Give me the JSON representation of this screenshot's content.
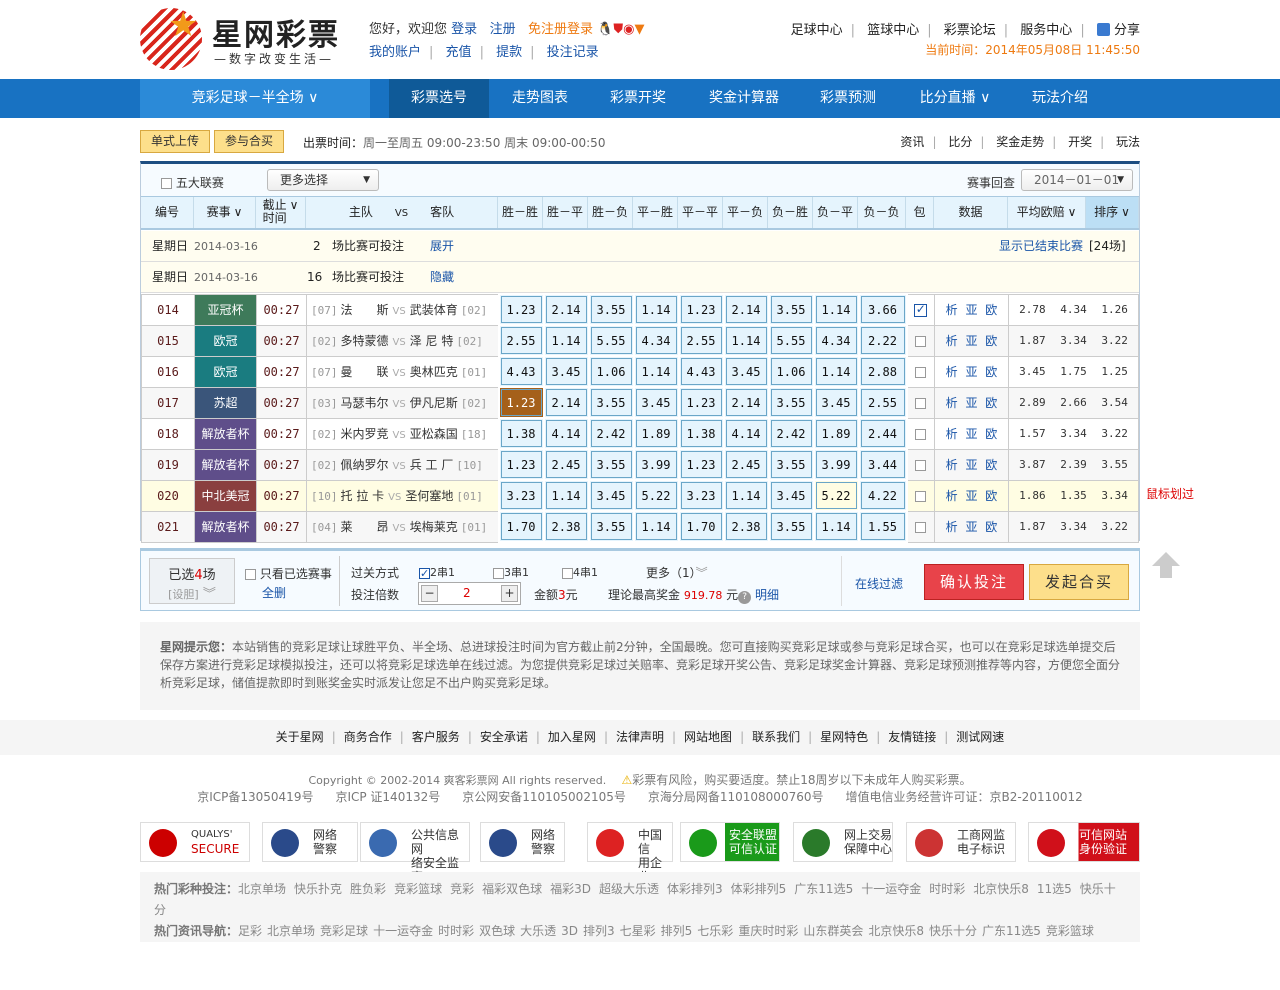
{
  "logo": {
    "name": "星网彩票",
    "slogan": "—数字改变生活—"
  },
  "header": {
    "greeting": "您好，欢迎您",
    "login": "登录",
    "register": "注册",
    "free_login": "免注册登录",
    "account": "我的账户",
    "recharge": "充值",
    "withdraw": "提款",
    "records": "投注记录",
    "right_links": [
      "足球中心",
      "篮球中心",
      "彩票论坛",
      "服务中心"
    ],
    "share": "分享",
    "time": "当前时间：2014年05月08日 11:45:50"
  },
  "nav": {
    "lottery": "竞彩足球－半全场",
    "items": [
      "彩票选号",
      "走势图表",
      "彩票开奖",
      "奖金计算器",
      "彩票预测",
      "比分直播",
      "玩法介绍"
    ],
    "active": 0
  },
  "toolbar": {
    "upload": "单式上传",
    "join": "参与合买",
    "ticket_label": "出票时间：",
    "ticket_time": "周一至周五 09:00-23:50  周末 09:00-00:50",
    "right_links": [
      "资讯",
      "比分",
      "奖金走势",
      "开奖",
      "玩法"
    ]
  },
  "filter": {
    "five_leagues": "五大联赛",
    "more": "更多选择",
    "review": "赛事回查",
    "date": "2014－01－01"
  },
  "columns": [
    "编号",
    "赛事",
    "截止时间",
    "主队",
    "VS",
    "客队",
    "胜－胜",
    "胜－平",
    "胜－负",
    "平－胜",
    "平－平",
    "平－负",
    "负－胜",
    "负－平",
    "负－负",
    "包",
    "数据",
    "平均欧赔",
    "排序"
  ],
  "groups": [
    {
      "day": "星期日",
      "date": "2014-03-16",
      "count": "2",
      "text": "场比赛可投注",
      "toggle": "展开",
      "show_ended": "显示已结束比赛",
      "ended_count": "[24场]"
    },
    {
      "day": "星期日",
      "date": "2014-03-16",
      "count": "16",
      "text": "场比赛可投注",
      "toggle": "隐藏"
    }
  ],
  "matches": [
    {
      "no": "014",
      "league": "亚冠杯",
      "color": "#3e7a5a",
      "time": "00:27",
      "hrank": "[07]",
      "home": "法　　斯",
      "away": "武装体育",
      "arank": "[02]",
      "odds": [
        "1.23",
        "2.14",
        "3.55",
        "1.14",
        "1.23",
        "2.14",
        "3.55",
        "1.14",
        "3.66"
      ],
      "checked": true,
      "avg": "2.78 4.34 1.26"
    },
    {
      "no": "015",
      "league": "欧冠",
      "color": "#1a7c80",
      "time": "00:27",
      "hrank": "[02]",
      "home": "多特蒙德",
      "away": "泽 尼 特",
      "arank": "[02]",
      "odds": [
        "2.55",
        "1.14",
        "5.55",
        "4.34",
        "2.55",
        "1.14",
        "5.55",
        "4.34",
        "2.22"
      ],
      "checked": false,
      "avg": "1.87 3.34 3.22"
    },
    {
      "no": "016",
      "league": "欧冠",
      "color": "#1a7c80",
      "time": "00:27",
      "hrank": "[07]",
      "home": "曼　　联",
      "away": "奥林匹克",
      "arank": "[01]",
      "odds": [
        "4.43",
        "3.45",
        "1.06",
        "1.14",
        "4.43",
        "3.45",
        "1.06",
        "1.14",
        "2.88"
      ],
      "checked": false,
      "avg": "3.45 1.75 1.25"
    },
    {
      "no": "017",
      "league": "苏超",
      "color": "#3a557a",
      "time": "00:27",
      "hrank": "[03]",
      "home": "马瑟韦尔",
      "away": "伊凡尼斯",
      "arank": "[02]",
      "odds": [
        "1.23",
        "2.14",
        "3.55",
        "3.45",
        "1.23",
        "2.14",
        "3.55",
        "3.45",
        "2.55"
      ],
      "checked": false,
      "selected_odd": 0,
      "avg": "2.89 2.66 3.54"
    },
    {
      "no": "018",
      "league": "解放者杯",
      "color": "#5f4e8a",
      "time": "00:27",
      "hrank": "[02]",
      "home": "米内罗竞",
      "away": "亚松森国",
      "arank": "[18]",
      "odds": [
        "1.38",
        "4.14",
        "2.42",
        "1.89",
        "1.38",
        "4.14",
        "2.42",
        "1.89",
        "2.44"
      ],
      "checked": false,
      "avg": "1.57 3.34 3.22"
    },
    {
      "no": "019",
      "league": "解放者杯",
      "color": "#5f4e8a",
      "time": "00:27",
      "hrank": "[02]",
      "home": "佩纳罗尔",
      "away": "兵 工 厂",
      "arank": "[10]",
      "odds": [
        "1.23",
        "2.45",
        "3.55",
        "3.99",
        "1.23",
        "2.45",
        "3.55",
        "3.99",
        "3.44"
      ],
      "checked": false,
      "avg": "3.87 2.39 3.55"
    },
    {
      "no": "020",
      "league": "中北美冠",
      "color": "#8a3f3f",
      "time": "00:27",
      "hrank": "[10]",
      "home": "托 拉 卡",
      "away": "圣何塞地",
      "arank": "[01]",
      "odds": [
        "3.23",
        "1.14",
        "3.45",
        "5.22",
        "3.23",
        "1.14",
        "3.45",
        "5.22",
        "4.22"
      ],
      "checked": false,
      "hover": true,
      "hover_odd": 7,
      "avg": "1.86 1.35 3.34"
    },
    {
      "no": "021",
      "league": "解放者杯",
      "color": "#5f4e8a",
      "time": "00:27",
      "hrank": "[04]",
      "home": "莱　　昂",
      "away": "埃梅莱克",
      "arank": "[01]",
      "odds": [
        "1.70",
        "2.38",
        "3.55",
        "1.14",
        "1.70",
        "2.38",
        "3.55",
        "1.14",
        "1.55"
      ],
      "checked": false,
      "avg": "1.87 3.34 3.22"
    }
  ],
  "data_links": "析 亚 欧",
  "hover_note": "鼠标划过",
  "betbar": {
    "selected_pre": "已选",
    "selected_count": "4",
    "selected_post": "场",
    "setting": "[设胆]",
    "only_selected": "只看已选赛事",
    "clear_all": "全删",
    "pass_label": "过关方式",
    "pass_options": [
      "2串1",
      "3串1",
      "4串1"
    ],
    "pass_checked": 0,
    "more": "更多（1）",
    "multiple_label": "投注倍数",
    "multiple": "2",
    "amount_label": "金额",
    "amount": "3",
    "yuan": "元",
    "max_prize_label": "理论最高奖金",
    "max_prize": "919.78",
    "detail": "明细",
    "filter": "在线过滤",
    "confirm": "确认投注",
    "group_buy": "发起合买"
  },
  "notice": {
    "title": "星网提示您：",
    "text": "本站销售的竞彩足球让球胜平负、半全场、总进球投注时间为官方截止前2分钟，全国最晚。您可直接购买竞彩足球或参与竞彩足球合买，也可以在竞彩足球选单提交后保存方案进行竞彩足球模拟投注，还可以将竞彩足球选单在线过滤。为您提供竞彩足球过关赔率、竞彩足球开奖公告、竞彩足球奖金计算器、竞彩足球预测推荐等内容，方便您全面分析竞彩足球，储值提款即时到账奖金实时派发让您足不出户购买竞彩足球。"
  },
  "footer_links": [
    "关于星网",
    "商务合作",
    "客户服务",
    "安全承诺",
    "加入星网",
    "法律声明",
    "网站地图",
    "联系我们",
    "星网特色",
    "友情链接",
    "测试网速"
  ],
  "copyright": {
    "line1": "Copyright © 2002-2014 爽客彩票网    All rights reserved.",
    "warning": "彩票有风险，购买要适度。禁止18周岁以下未成年人购买彩票。",
    "icp": [
      "京ICP备13050419号",
      "京ICP 证140132号",
      "京公网安备110105002105号",
      "京海分局网备110108000760号",
      "增值电信业务经营许可证：京B2-20110012"
    ]
  },
  "badges": [
    {
      "l1": "QUALYS'",
      "l2": "SECURE",
      "color": "#c00"
    },
    {
      "l1": "网络",
      "l2": "警察",
      "color": "#2a4a8a"
    },
    {
      "l1": "公共信息网",
      "l2": "络安全监察",
      "color": "#3a6ab0"
    },
    {
      "l1": "网络",
      "l2": "警察",
      "color": "#2a4a8a"
    },
    {
      "l1": "中国信",
      "l2": "用企业",
      "color": "#d22"
    },
    {
      "l1": "安全联盟",
      "l2": "可信认证",
      "color": "#1a9a1a"
    },
    {
      "l1": "网上交易",
      "l2": "保障中心",
      "color": "#2a7a2a"
    },
    {
      "l1": "工商网监",
      "l2": "电子标识",
      "color": "#c33"
    },
    {
      "l1": "可信网站",
      "l2": "身份验证",
      "color": "#d0101a"
    }
  ],
  "hot": {
    "lottery_label": "热门彩种投注：",
    "lottery": [
      "北京单场",
      "快乐扑克",
      "胜负彩",
      "竞彩篮球",
      "竞彩",
      "福彩双色球",
      "福彩3D",
      "超级大乐透",
      "体彩排列3",
      "体彩排列5",
      "广东11选5",
      "十一运夺金",
      "时时彩",
      "北京快乐8",
      "11选5",
      "快乐十分"
    ],
    "news_label": "热门资讯导航：",
    "news": [
      "足彩",
      "北京单场",
      "竞彩足球",
      "十一运夺金",
      "时时彩",
      "双色球",
      "大乐透",
      "3D",
      "排列3",
      "七星彩",
      "排列5",
      "七乐彩",
      "重庆时时彩",
      "山东群英会",
      "北京快乐8",
      "快乐十分",
      "广东11选5",
      "竞彩篮球"
    ]
  }
}
